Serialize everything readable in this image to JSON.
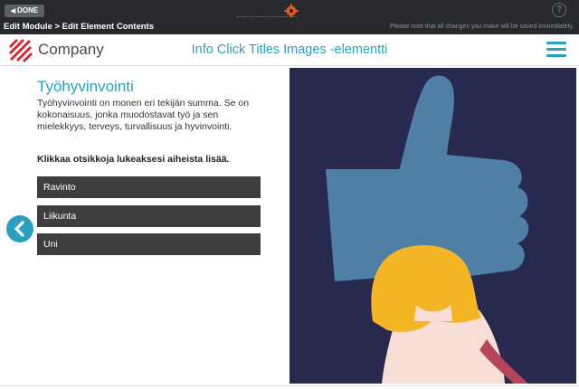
{
  "toolbar": {
    "done_label": "DONE",
    "breadcrumb": "Edit Module > Edit Element Contents",
    "save_note": "Please note that all changes you make will be saved immediately.",
    "help_label": "?"
  },
  "header": {
    "logo_text": "Company",
    "title": "Info Click Titles Images -elementti"
  },
  "content": {
    "heading": "Työhyvinvointi",
    "body": "Työhyvinvointi on monen eri tekijän summa. Se on kokonaisuus, jonka muodostavat työ ja sen mielekkyys, terveys, turvallisuus ja hyvinvointi.",
    "instruction": "Klikkaa otsikkoja lukeaksesi aiheista lisää.",
    "buttons": [
      {
        "label": "Ravinto"
      },
      {
        "label": "Liikunta"
      },
      {
        "label": "Uni"
      }
    ]
  },
  "colors": {
    "accent": "#2aa0c0",
    "logo_red": "#d8222f",
    "button_bg": "#3e3e3e",
    "illustration_bg": "#27294f",
    "thumb": "#4f7fa6",
    "hair": "#f5b626",
    "shirt": "#f9ded8",
    "arm": "#b5455a"
  },
  "icons": {
    "back": "triangle-left-icon",
    "settings": "gear-icon",
    "help": "question-icon",
    "menu": "hamburger-icon",
    "prev": "chevron-left-icon"
  }
}
